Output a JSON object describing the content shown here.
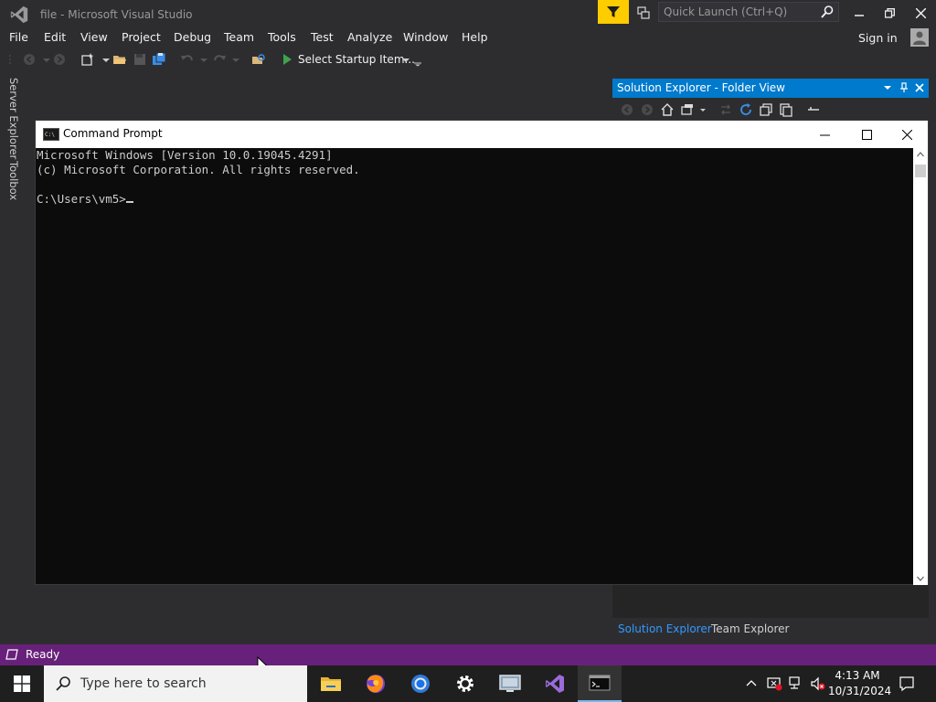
{
  "vs": {
    "title": "file - Microsoft Visual Studio",
    "quick_launch_placeholder": "Quick Launch (Ctrl+Q)",
    "menu": [
      "File",
      "Edit",
      "View",
      "Project",
      "Debug",
      "Team",
      "Tools",
      "Test",
      "Analyze",
      "Window",
      "Help"
    ],
    "sign_in": "Sign in",
    "startup_item": "Select Startup Item...",
    "side_tabs": [
      "Server Explorer",
      "Toolbox"
    ],
    "status": "Ready",
    "colors": {
      "accent": "#007acc",
      "status_bar": "#68217a",
      "feedback": "#ffcc00",
      "bg": "#2d2d30"
    }
  },
  "solution_explorer": {
    "title": "Solution Explorer - Folder View",
    "tabs": [
      "Solution Explorer",
      "Team Explorer"
    ]
  },
  "cmd": {
    "title": "Command Prompt",
    "lines": [
      "Microsoft Windows [Version 10.0.19045.4291]",
      "(c) Microsoft Corporation. All rights reserved.",
      "",
      "C:\\Users\\vm5>"
    ]
  },
  "taskbar": {
    "search_placeholder": "Type here to search",
    "apps": [
      "file-explorer-icon",
      "firefox-icon",
      "chrome-icon",
      "settings-icon",
      "remote-desktop-icon",
      "visual-studio-icon",
      "command-prompt-icon"
    ],
    "time": "4:13 AM",
    "date": "10/31/2024"
  }
}
